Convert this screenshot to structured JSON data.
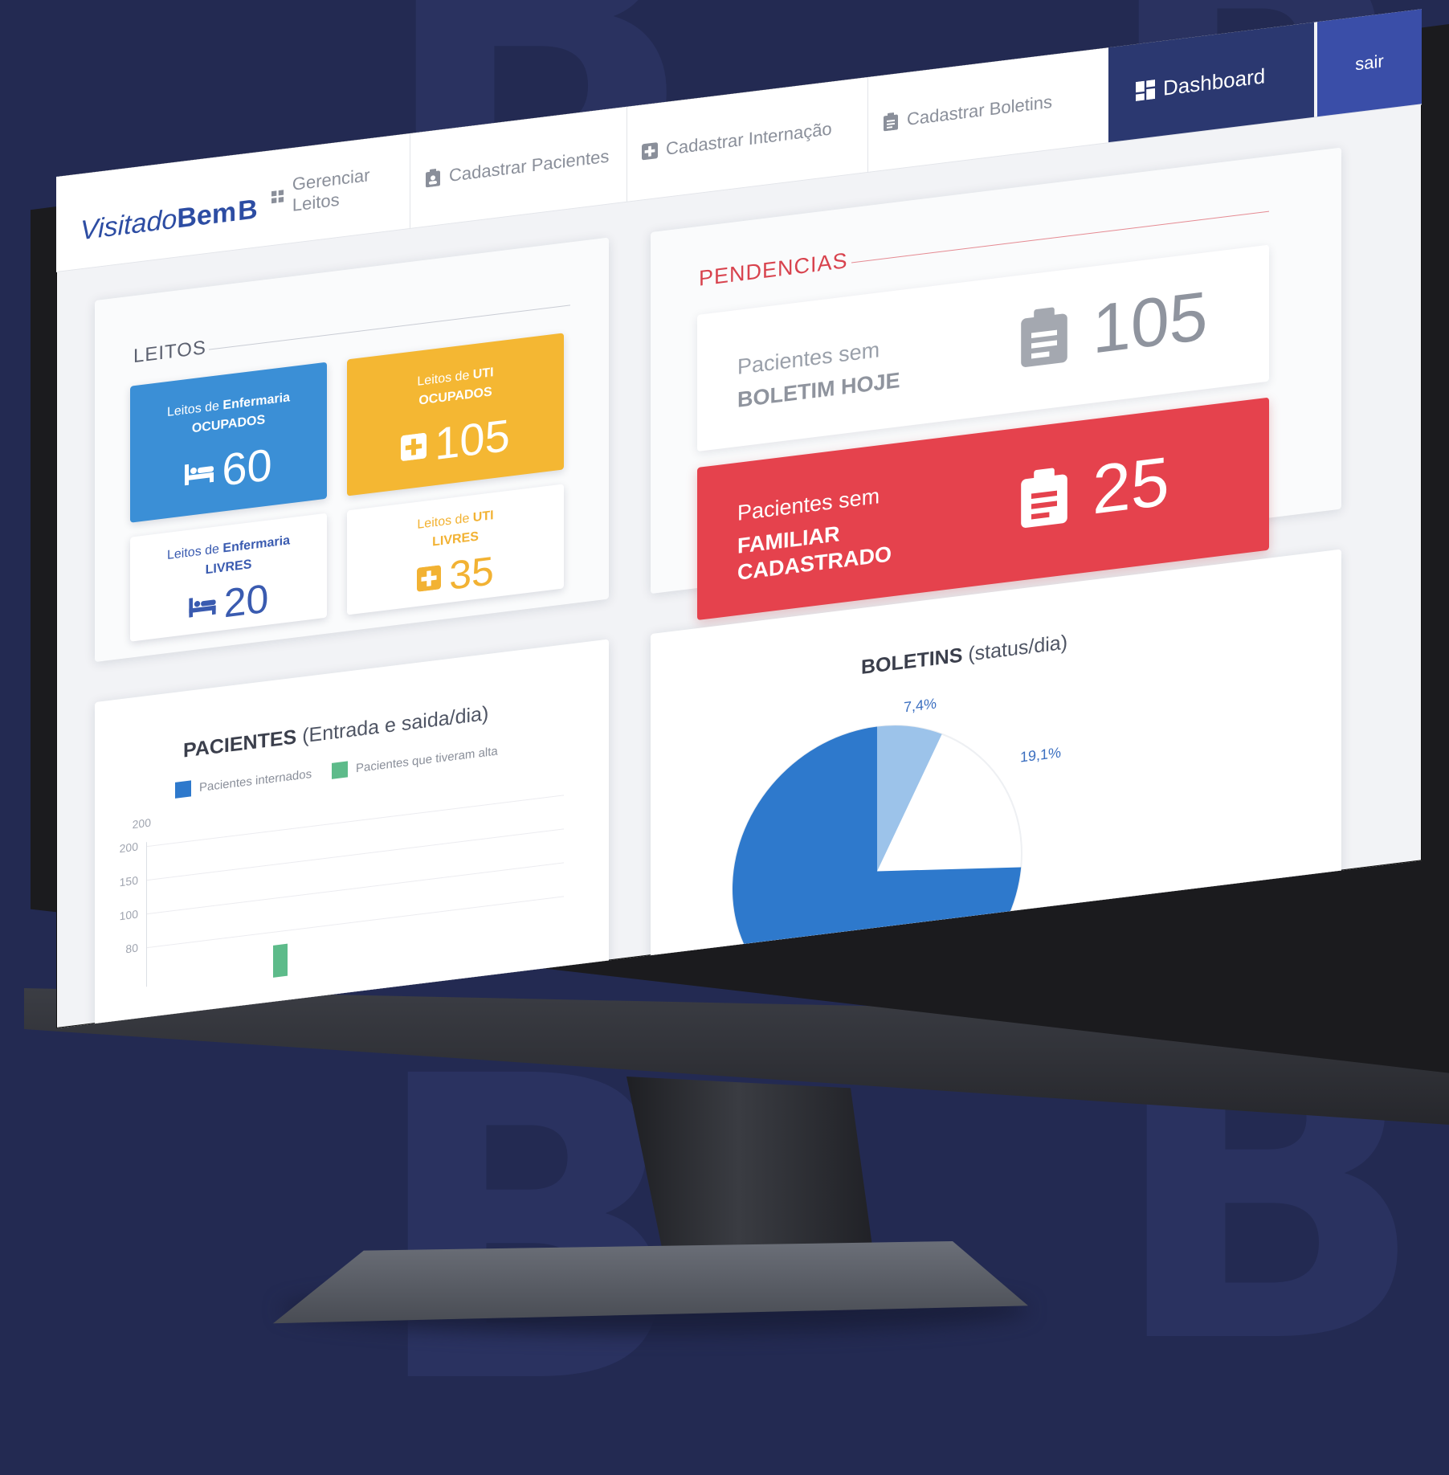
{
  "background_glyphs": [
    "B",
    "B",
    "B",
    "B"
  ],
  "app": {
    "logo_light": "Visitado",
    "logo_bold": "Bem",
    "logo_mark": "B"
  },
  "nav": {
    "items": [
      {
        "label": "Gerenciar Leitos",
        "icon": "grid-icon"
      },
      {
        "label": "Cadastrar Pacientes",
        "icon": "clipboard-user-icon"
      },
      {
        "label": "Cadastrar Internação",
        "icon": "plus-square-icon"
      },
      {
        "label": "Cadastrar Boletins",
        "icon": "clipboard-list-icon"
      },
      {
        "label": "Dashboard",
        "icon": "dashboard-icon",
        "active": true
      }
    ],
    "logout": "sair"
  },
  "leitos": {
    "title": "LEITOS",
    "tiles": [
      {
        "line1_prefix": "Leitos de ",
        "line1_bold": "Enfermaria",
        "line2": "OCUPADOS",
        "value": "60",
        "icon": "bed-icon",
        "color": "#3b8fd6"
      },
      {
        "line1_prefix": "Leitos de ",
        "line1_bold": "UTI",
        "line2": "OCUPADOS",
        "value": "105",
        "icon": "medical-cross-icon",
        "color": "#f4b733"
      },
      {
        "line1_prefix": "Leitos de ",
        "line1_bold": "Enfermaria",
        "line2": "LIVRES",
        "value": "20",
        "icon": "bed-icon",
        "color": "#3a5bb0"
      },
      {
        "line1_prefix": "Leitos de ",
        "line1_bold": "UTI",
        "line2": "LIVRES",
        "value": "35",
        "icon": "medical-cross-icon",
        "color": "#f2b233"
      }
    ]
  },
  "pendencias": {
    "title": "PENDENCIAS",
    "cards": [
      {
        "label": "Pacientes sem",
        "bold_lines": [
          "BOLETIM HOJE"
        ],
        "value": "105",
        "icon": "clipboard-list-icon"
      },
      {
        "label": "Pacientes sem",
        "bold_lines": [
          "FAMILIAR",
          "CADASTRADO"
        ],
        "value": "25",
        "icon": "clipboard-list-icon"
      }
    ]
  },
  "pacientes_chart": {
    "title_bold": "PACIENTES",
    "title_rest": "(Entrada e saida/dia)",
    "legend": [
      "Pacientes internados",
      "Pacientes que tiveram alta"
    ],
    "y_ticks": [
      "200",
      "200",
      "150",
      "100",
      "80"
    ]
  },
  "boletins_chart": {
    "title_bold": "BOLETINS",
    "title_rest": "(status/dia)",
    "labels": [
      "7,4%",
      "19,1%"
    ]
  },
  "chart_data": [
    {
      "type": "bar",
      "title": "PACIENTES (Entrada e saida/dia)",
      "series": [
        {
          "name": "Pacientes internados",
          "values": []
        },
        {
          "name": "Pacientes que tiveram alta",
          "values": []
        }
      ],
      "y_ticks": [
        200,
        200,
        150,
        100,
        80
      ],
      "legend": "top",
      "grid": true
    },
    {
      "type": "pie",
      "title": "BOLETINS (status/dia)",
      "slices": [
        {
          "value": 7.4,
          "label": "7,4%",
          "color": "#9cc3ea"
        },
        {
          "value": 19.1,
          "label": "19,1%",
          "color": "#ffffff"
        },
        {
          "value": 73.5,
          "color": "#2e79cc"
        }
      ]
    }
  ],
  "colors": {
    "bg": "#232a52",
    "nav_active": "#2b3870",
    "logout": "#3a4ea8",
    "blue": "#3b8fd6",
    "yellow": "#f4b733",
    "red": "#e5424d",
    "green": "#5dbb8a"
  }
}
